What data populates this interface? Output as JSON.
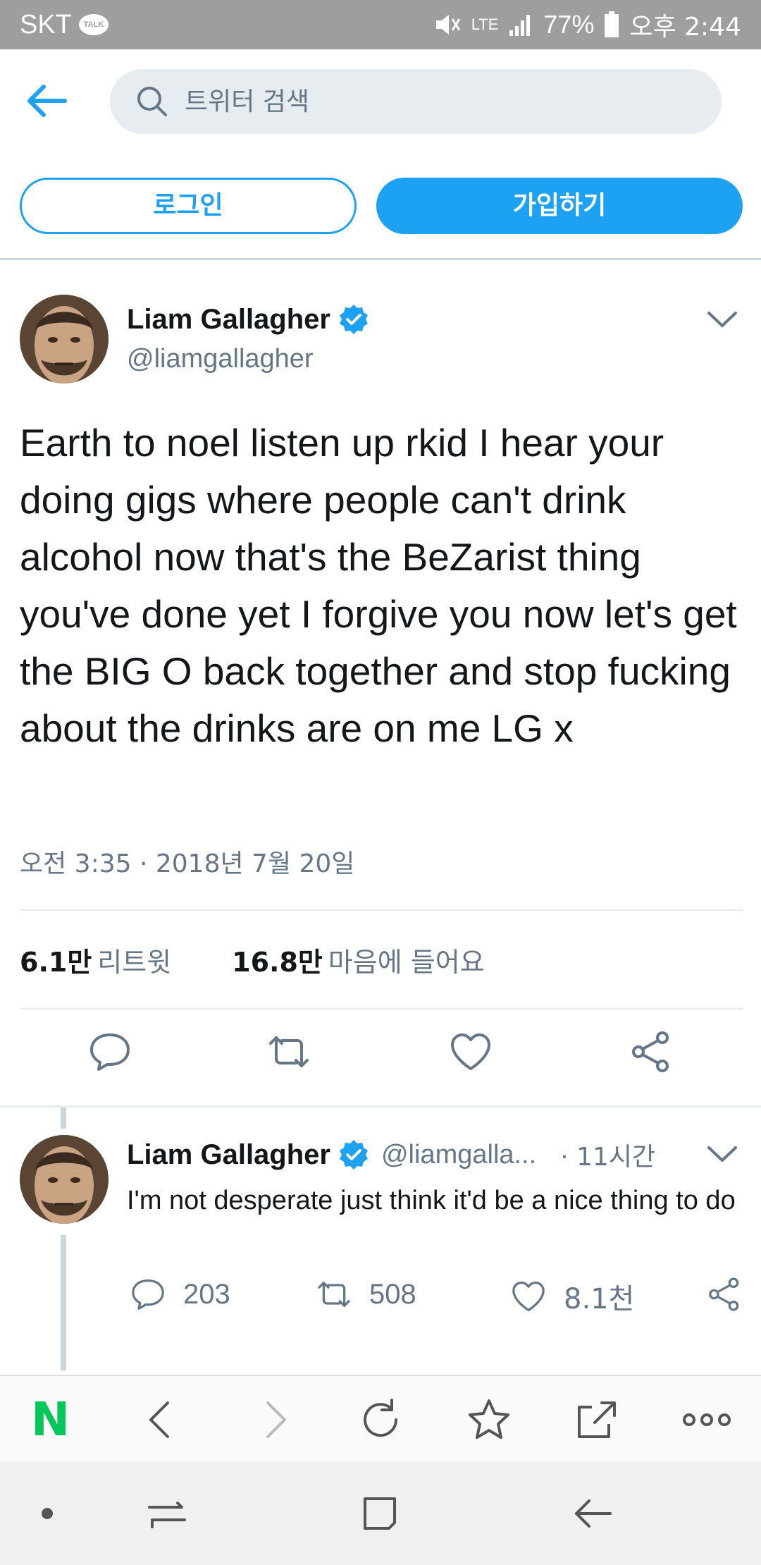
{
  "status_bar": {
    "carrier": "SKT",
    "talk_badge": "TALK",
    "network": "LTE",
    "battery": "77%",
    "time": "오후 2:44"
  },
  "search": {
    "placeholder": "트위터 검색"
  },
  "auth": {
    "login_label": "로그인",
    "signup_label": "가입하기"
  },
  "main_tweet": {
    "author_name": "Liam Gallagher",
    "author_handle": "@liamgallagher",
    "text": "Earth to noel listen up rkid I hear your doing gigs where people can't drink alcohol now that's the BeZarist thing you've done yet I forgive you now let's get the BIG O back together and stop fucking about the drinks are on me LG x",
    "timestamp": "오전 3:35 · 2018년 7월 20일",
    "retweet_count": "6.1만",
    "retweet_label": "리트윗",
    "like_count": "16.8만",
    "like_label": "마음에 들어요"
  },
  "reply_tweet": {
    "author_name": "Liam Gallagher",
    "author_handle": "@liamgalla...",
    "time": "· 11시간",
    "text": "I'm not desperate just think it'd be a nice thing to do",
    "reply_count": "203",
    "retweet_count": "508",
    "like_count": "8.1천"
  },
  "colors": {
    "accent": "#1da1f2",
    "secondary_text": "#657786",
    "naver_green": "#03c75a"
  },
  "icons": {
    "toolbar": [
      "naver-logo",
      "back-icon",
      "forward-icon",
      "refresh-icon",
      "bookmark-star-icon",
      "share-icon",
      "more-icon"
    ],
    "nav": [
      "dot-icon",
      "recents-icon",
      "home-icon",
      "back-icon"
    ]
  },
  "browser": {
    "logo_letter": "N"
  }
}
